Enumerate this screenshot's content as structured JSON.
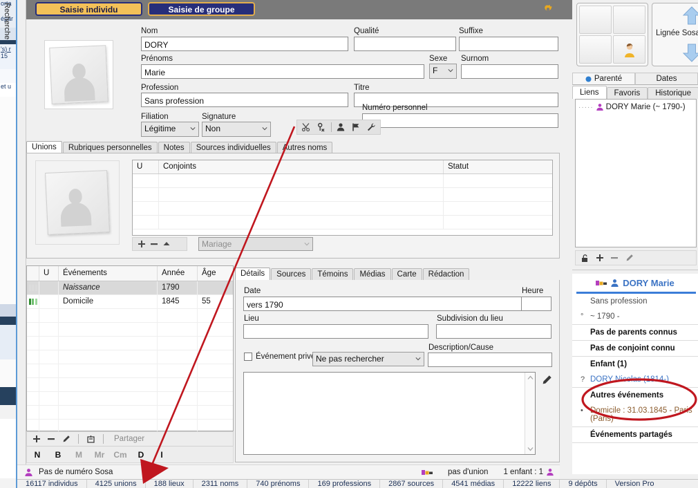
{
  "background_window": {
    "fragments": [
      "orta",
      "épar",
      "'s) r",
      "15",
      "et u"
    ]
  },
  "vertical_tab": {
    "label": "Recherche"
  },
  "modebar": {
    "individu_label": "Saisie individu",
    "groupe_label": "Saisie de groupe",
    "gear_icon": "gear-icon"
  },
  "identity": {
    "nom": {
      "label": "Nom",
      "value": "DORY"
    },
    "qualite": {
      "label": "Qualité",
      "value": ""
    },
    "suffixe": {
      "label": "Suffixe",
      "value": ""
    },
    "prenoms": {
      "label": "Prénoms",
      "value": "Marie"
    },
    "sexe": {
      "label": "Sexe",
      "value": "F"
    },
    "surnom": {
      "label": "Surnom",
      "value": ""
    },
    "profession": {
      "label": "Profession",
      "value": "Sans profession"
    },
    "titre": {
      "label": "Titre",
      "value": ""
    },
    "filiation": {
      "label": "Filiation",
      "value": "Légitime"
    },
    "signature": {
      "label": "Signature",
      "value": "Non"
    },
    "numero_personnel": {
      "label": "Numéro personnel",
      "value": ""
    },
    "icons": [
      "scissors-icon",
      "detach-person-icon",
      "person-icon",
      "flag-icon",
      "wrench-icon"
    ]
  },
  "main_tabs": [
    {
      "label": "Unions",
      "active": true
    },
    {
      "label": "Rubriques personnelles",
      "active": false
    },
    {
      "label": "Notes",
      "active": false
    },
    {
      "label": "Sources individuelles",
      "active": false
    },
    {
      "label": "Autres noms",
      "active": false
    }
  ],
  "unions": {
    "columns": [
      "U",
      "Conjoints",
      "Statut"
    ],
    "rows": [],
    "empty_row_count": 5,
    "toolbar_icons": [
      "add-icon",
      "remove-icon",
      "up-icon"
    ],
    "union_type": {
      "value": "Mariage"
    }
  },
  "events": {
    "columns": [
      "",
      "U",
      "Événements",
      "Année",
      "Âge"
    ],
    "rows": [
      {
        "marker": "gray",
        "u": "",
        "name": "Naissance",
        "annee": "1790",
        "age": "",
        "selected": true
      },
      {
        "marker": "green",
        "u": "",
        "name": "Domicile",
        "annee": "1845",
        "age": "55",
        "selected": false
      }
    ],
    "empty_row_count": 10,
    "toolbar_icons": [
      "add-icon",
      "remove-icon",
      "edit-icon",
      "merge-icon"
    ],
    "share_label": "Partager",
    "letters": [
      {
        "label": "N",
        "enabled": true
      },
      {
        "label": "B",
        "enabled": true
      },
      {
        "label": "M",
        "enabled": false
      },
      {
        "label": "Mr",
        "enabled": false
      },
      {
        "label": "Cm",
        "enabled": false
      },
      {
        "label": "D",
        "enabled": true
      },
      {
        "label": "I",
        "enabled": true
      }
    ]
  },
  "details": {
    "tabs": [
      {
        "label": "Détails",
        "active": true
      },
      {
        "label": "Sources",
        "active": false
      },
      {
        "label": "Témoins",
        "active": false
      },
      {
        "label": "Médias",
        "active": false
      },
      {
        "label": "Carte",
        "active": false
      },
      {
        "label": "Rédaction",
        "active": false
      }
    ],
    "date": {
      "label": "Date",
      "value": "vers 1790"
    },
    "heure": {
      "label": "Heure",
      "value": ""
    },
    "lieu": {
      "label": "Lieu",
      "value": ""
    },
    "subdivision": {
      "label": "Subdivision du lieu",
      "value": ""
    },
    "prive": {
      "label": "Événement privé",
      "checked": false
    },
    "recherche_select": {
      "value": "Ne pas rechercher"
    },
    "description": {
      "label": "Description/Cause",
      "value": ""
    },
    "note": {
      "value": ""
    },
    "pencil_icon": "pencil-icon"
  },
  "sidebar": {
    "quadrant": {
      "icons": [
        "empty",
        "empty",
        "empty",
        "person-avatar-icon"
      ]
    },
    "lignee": {
      "label": "Lignée Sosa",
      "up_icon": "arrow-up-icon",
      "down_icon": "arrow-down-icon"
    },
    "tabs_row1": [
      {
        "label": "Parenté",
        "active": true,
        "icon": "blue-dot-icon"
      },
      {
        "label": "Dates",
        "active": false
      }
    ],
    "tabs_row2": [
      {
        "label": "Liens",
        "active": true
      },
      {
        "label": "Favoris",
        "active": false
      },
      {
        "label": "Historique",
        "active": false
      }
    ],
    "liens": [
      {
        "icon": "person-purple-icon",
        "label": "DORY Marie (~ 1790-)"
      }
    ],
    "lock_toolbar_icons": [
      "unlock-icon",
      "add-icon",
      "remove-icon",
      "edit-icon"
    ]
  },
  "person_card": {
    "name": "DORY Marie",
    "name_icon": "person-blue-icon",
    "flag_icon": "color-flag-icon",
    "profession": "Sans profession",
    "birth_bullet": "°",
    "birth": "~ 1790 -",
    "parents": "Pas de parents connus",
    "spouse": "Pas de conjoint connu",
    "children_header": "Enfant (1)",
    "children": [
      {
        "marker": "?",
        "label": "DORY Nicolas (1814-)"
      }
    ],
    "other_events_header": "Autres événements",
    "other_events": [
      {
        "marker": "•",
        "label": "Domicile : 31.03.1845 - Paris (Paris)"
      }
    ],
    "shared_events_header": "Événements partagés"
  },
  "sosa_bar": {
    "icon": "person-purple-icon",
    "label": "Pas de numéro Sosa",
    "flag_icon": "color-flag-icon",
    "union_status": "pas d'union",
    "children_status": "1 enfant : 1",
    "children_icon": "person-purple-icon"
  },
  "statusbar": {
    "cells": [
      "16117 individus",
      "4125 unions",
      "188 lieux",
      "2311 noms",
      "740 prénoms",
      "169  professions",
      "2867 sources",
      "4541  médias",
      "12222 liens",
      "9 dépôts",
      "Version Pro"
    ]
  },
  "annotations": {
    "arrow_color": "#c0171f",
    "ellipse_color": "#c0171f"
  }
}
